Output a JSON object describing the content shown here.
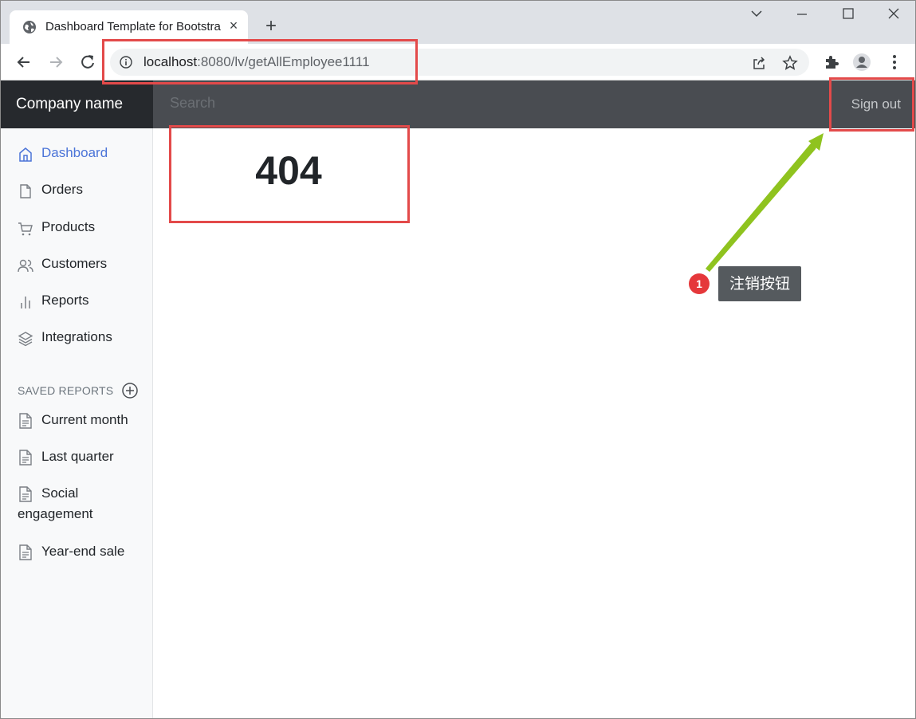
{
  "browser": {
    "tab_title": "Dashboard Template for Bootstrap",
    "tab_close": "×",
    "new_tab": "+",
    "url_host": "localhost",
    "url_rest": ":8080/lv/getAllEmployee1111"
  },
  "navbar": {
    "brand": "Company name",
    "search_placeholder": "Search",
    "signout_label": "Sign out"
  },
  "sidebar": {
    "items": [
      {
        "label": "Dashboard",
        "icon": "home-icon",
        "active": true
      },
      {
        "label": "Orders",
        "icon": "file-icon"
      },
      {
        "label": "Products",
        "icon": "shopping-cart-icon"
      },
      {
        "label": "Customers",
        "icon": "users-icon"
      },
      {
        "label": "Reports",
        "icon": "bar-chart-icon"
      },
      {
        "label": "Integrations",
        "icon": "layers-icon"
      }
    ],
    "saved_heading": "SAVED REPORTS",
    "reports": [
      {
        "label": "Current month",
        "icon": "file-text-icon"
      },
      {
        "label": "Last quarter",
        "icon": "file-text-icon"
      },
      {
        "label": "Social engagement",
        "icon": "file-text-icon"
      },
      {
        "label": "Year-end sale",
        "icon": "file-text-icon"
      }
    ]
  },
  "main": {
    "error_code": "404"
  },
  "annotation": {
    "badge_number": "1",
    "tooltip_text": "注销按钮"
  },
  "colors": {
    "highlight": "#e34a4a",
    "active_link": "#4b74d8",
    "arrow": "#8fc31f",
    "badge": "#e5383b"
  }
}
